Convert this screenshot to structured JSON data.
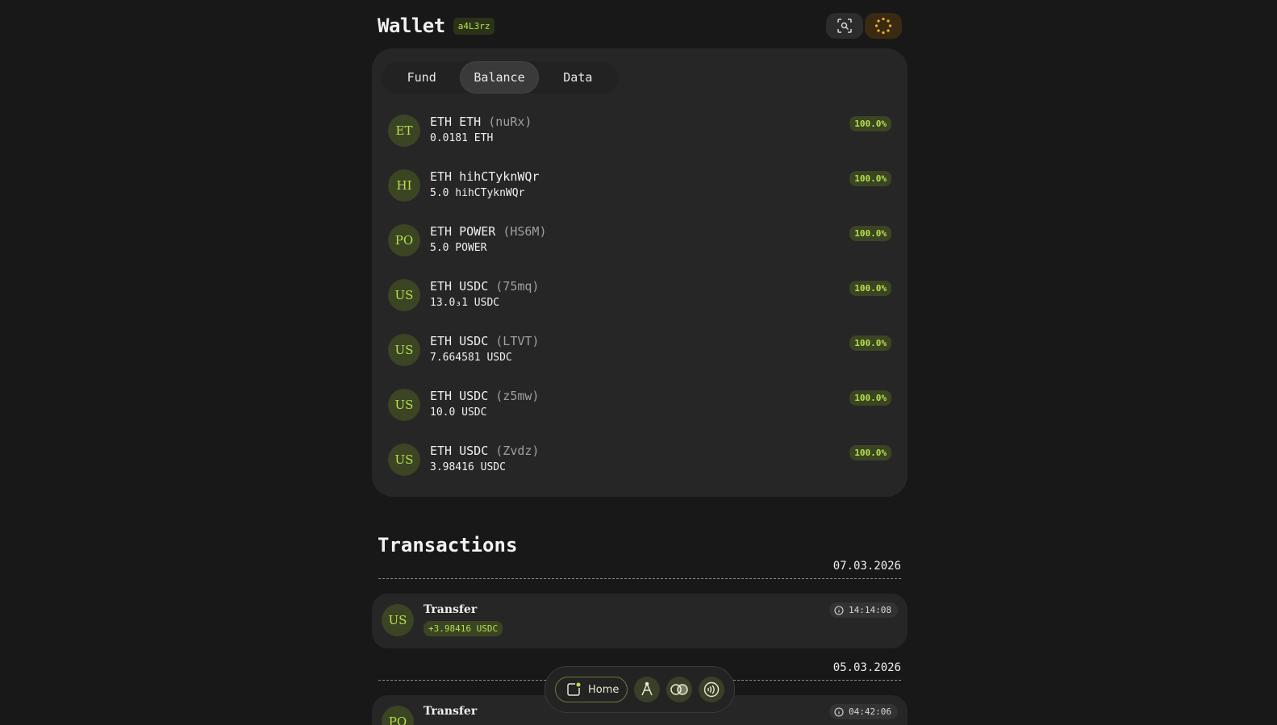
{
  "header": {
    "title": "Wallet",
    "wallet_id": "a4L3rz",
    "scan_icon": "scan-icon",
    "loader_icon": "loading-icon"
  },
  "tabs": [
    {
      "label": "Fund",
      "active": false
    },
    {
      "label": "Balance",
      "active": true
    },
    {
      "label": "Data",
      "active": false
    }
  ],
  "assets": [
    {
      "avatar": "ET",
      "name": "ETH ETH",
      "sub": "(nuRx)",
      "amount": "0.0181 ETH",
      "percent": "100.0%"
    },
    {
      "avatar": "HI",
      "name": "ETH hihCTyknWQr",
      "sub": "",
      "amount": "5.0 hihCTyknWQr",
      "percent": "100.0%"
    },
    {
      "avatar": "PO",
      "name": "ETH POWER",
      "sub": "(HS6M)",
      "amount": "5.0 POWER",
      "percent": "100.0%"
    },
    {
      "avatar": "US",
      "name": "ETH USDC",
      "sub": "(75mq)",
      "amount": "13.0₃1 USDC",
      "percent": "100.0%"
    },
    {
      "avatar": "US",
      "name": "ETH USDC",
      "sub": "(LTVT)",
      "amount": "7.664581 USDC",
      "percent": "100.0%"
    },
    {
      "avatar": "US",
      "name": "ETH USDC",
      "sub": "(z5mw)",
      "amount": "10.0 USDC",
      "percent": "100.0%"
    },
    {
      "avatar": "US",
      "name": "ETH USDC",
      "sub": "(Zvdz)",
      "amount": "3.98416 USDC",
      "percent": "100.0%"
    }
  ],
  "transactions": {
    "title": "Transactions",
    "groups": [
      {
        "date": "07.03.2026",
        "items": [
          {
            "avatar": "US",
            "type": "Transfer",
            "amount": "+3.98416 USDC",
            "time": "14:14:08"
          }
        ]
      },
      {
        "date": "05.03.2026",
        "items": [
          {
            "avatar": "PO",
            "type": "Transfer",
            "amount": "",
            "time": "04:42:06"
          }
        ]
      }
    ]
  },
  "bottom_nav": {
    "home_label": "Home",
    "icons": [
      "home-icon",
      "apps-icon",
      "toggle-icon",
      "signal-icon"
    ]
  },
  "colors": {
    "background": "#181818",
    "card": "#262626",
    "accent": "#b6e04a",
    "accent_bg": "#3b4423",
    "loader": "#f0b429"
  }
}
